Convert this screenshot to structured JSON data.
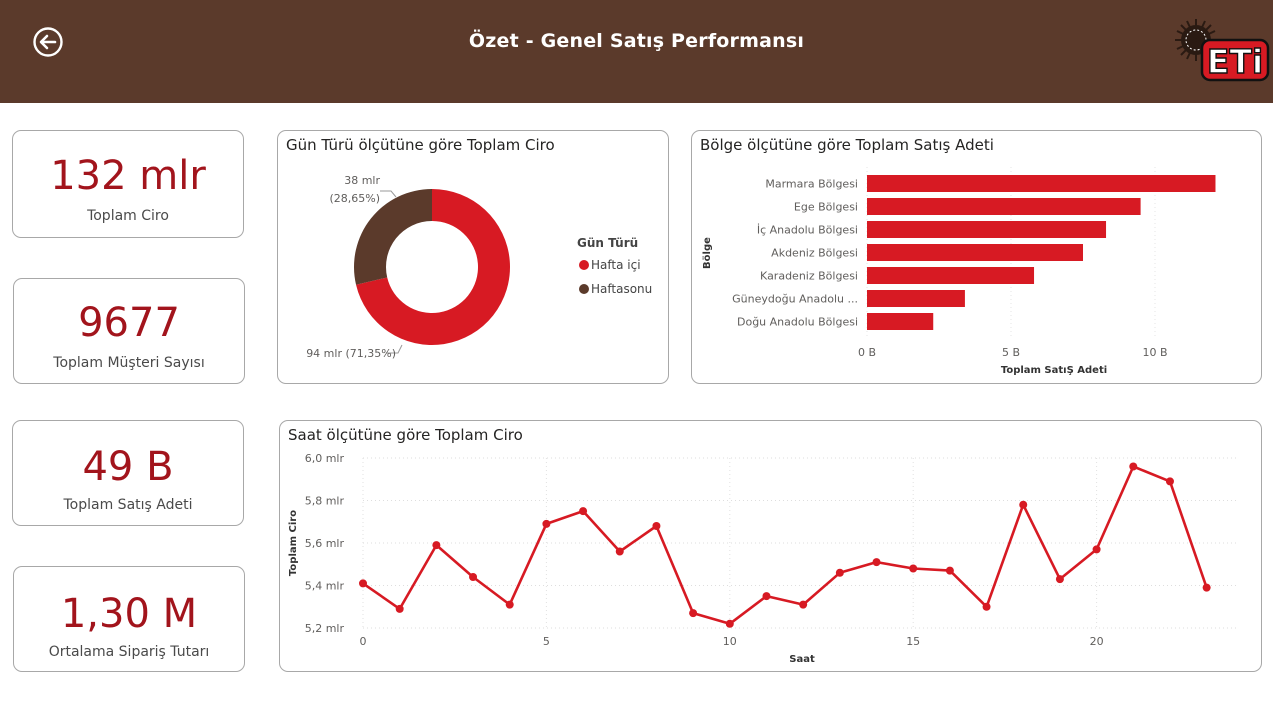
{
  "header": {
    "title": "Özet - Genel Satış Performansı",
    "logo_text": "ETi",
    "colors": {
      "header_bg": "#5b3a2b",
      "accent": "#d71a23",
      "kpi_value": "#a2141c",
      "brown": "#5b3a2b"
    }
  },
  "kpis": [
    {
      "value": "132 mlr",
      "label": "Toplam Ciro"
    },
    {
      "value": "9677",
      "label": "Toplam Müşteri Sayısı"
    },
    {
      "value": "49 B",
      "label": "Toplam Satış Adeti"
    },
    {
      "value": "1,30 M",
      "label": "Ortalama Sipariş Tutarı"
    }
  ],
  "chart_data": [
    {
      "type": "pie",
      "title": "Gün Türü ölçütüne göre Toplam Ciro",
      "legend_title": "Gün Türü",
      "slices": [
        {
          "name": "Hafta içi",
          "value": 71.35,
          "label": "94 mlr (71,35%)",
          "color": "#d71a23"
        },
        {
          "name": "Haftasonu",
          "value": 28.65,
          "label_line1": "38 mlr",
          "label_line2": "(28,65%)",
          "color": "#5b3a2b"
        }
      ],
      "legend_placement": "right"
    },
    {
      "type": "bar",
      "orientation": "horizontal",
      "title": "Bölge ölçütüne göre Toplam Satış Adeti",
      "ylabel": "Bölge",
      "xlabel": "Toplam SatıŞ Adeti",
      "categories": [
        "Marmara Bölgesi",
        "Ege Bölgesi",
        "İç Anadolu Bölgesi",
        "Akdeniz Bölgesi",
        "Karadeniz Bölgesi",
        "Güneydoğu Anadolu ...",
        "Doğu Anadolu Bölgesi"
      ],
      "values": [
        12.1,
        9.5,
        8.3,
        7.5,
        5.8,
        3.4,
        2.3
      ],
      "unit": "B",
      "xlim": [
        0,
        12.5
      ],
      "xticks": [
        {
          "v": 0,
          "label": "0 B"
        },
        {
          "v": 5,
          "label": "5 B"
        },
        {
          "v": 10,
          "label": "10 B"
        }
      ],
      "color": "#d71a23",
      "grid": true
    },
    {
      "type": "line",
      "title": "Saat ölçütüne göre Toplam Ciro",
      "xlabel": "Saat",
      "ylabel": "Toplam Ciro",
      "x": [
        0,
        1,
        2,
        3,
        4,
        5,
        6,
        7,
        8,
        9,
        10,
        11,
        12,
        13,
        14,
        15,
        16,
        17,
        18,
        19,
        20,
        21,
        22,
        23
      ],
      "values": [
        5.41,
        5.29,
        5.59,
        5.44,
        5.31,
        5.69,
        5.75,
        5.56,
        5.68,
        5.27,
        5.22,
        5.35,
        5.31,
        5.46,
        5.51,
        5.48,
        5.47,
        5.3,
        5.78,
        5.43,
        5.57,
        5.96,
        5.89,
        5.39
      ],
      "unit": "mlr",
      "xlim": [
        0,
        24
      ],
      "ylim": [
        5.2,
        6.0
      ],
      "xticks": [
        {
          "v": 0,
          "label": "0"
        },
        {
          "v": 5,
          "label": "5"
        },
        {
          "v": 10,
          "label": "10"
        },
        {
          "v": 15,
          "label": "15"
        },
        {
          "v": 20,
          "label": "20"
        }
      ],
      "yticks": [
        {
          "v": 5.2,
          "label": "5,2 mlr"
        },
        {
          "v": 5.4,
          "label": "5,4 mlr"
        },
        {
          "v": 5.6,
          "label": "5,6 mlr"
        },
        {
          "v": 5.8,
          "label": "5,8 mlr"
        },
        {
          "v": 6.0,
          "label": "6,0 mlr"
        }
      ],
      "color": "#d71a23",
      "grid": true
    }
  ]
}
